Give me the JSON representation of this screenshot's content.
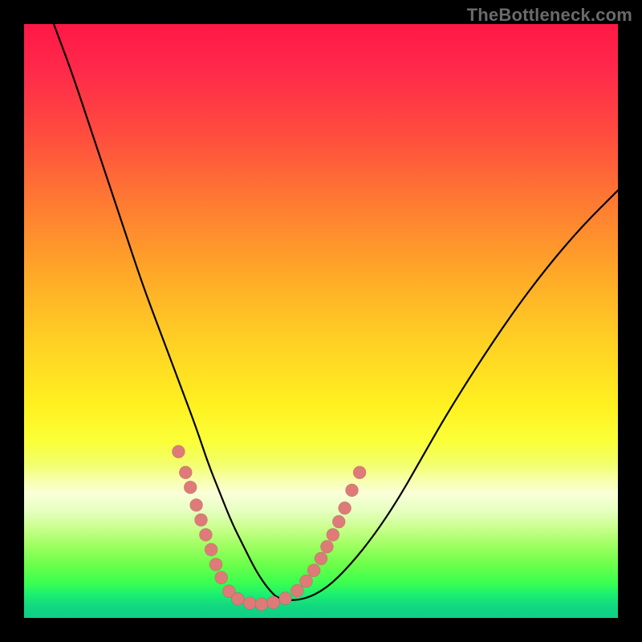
{
  "watermark": "TheBottleneck.com",
  "chart_data": {
    "type": "line",
    "title": "",
    "xlabel": "",
    "ylabel": "",
    "xlim": [
      0,
      100
    ],
    "ylim": [
      0,
      100
    ],
    "legend": false,
    "grid": false,
    "series": [
      {
        "name": "bottleneck-curve",
        "x": [
          5,
          8,
          11,
          14,
          17,
          20,
          23,
          26,
          29,
          31,
          33,
          35,
          37,
          39,
          41,
          43,
          47,
          51,
          55,
          59,
          63,
          67,
          71,
          76,
          82,
          88,
          94,
          100
        ],
        "values": [
          100,
          92,
          83,
          74,
          65,
          56,
          48,
          40,
          32,
          26,
          21,
          16,
          12,
          8,
          5,
          3,
          3,
          5,
          9,
          14,
          20,
          27,
          34,
          42,
          51,
          59,
          66,
          72
        ]
      }
    ],
    "markers": {
      "name": "curve-beads",
      "color": "#de7a78",
      "points_xy": [
        [
          26.0,
          28.0
        ],
        [
          27.2,
          24.5
        ],
        [
          28.0,
          22.0
        ],
        [
          29.0,
          19.0
        ],
        [
          29.8,
          16.5
        ],
        [
          30.6,
          14.0
        ],
        [
          31.5,
          11.5
        ],
        [
          32.3,
          9.0
        ],
        [
          33.2,
          6.8
        ],
        [
          34.5,
          4.5
        ],
        [
          36.0,
          3.2
        ],
        [
          38.0,
          2.5
        ],
        [
          40.0,
          2.3
        ],
        [
          42.0,
          2.6
        ],
        [
          44.0,
          3.3
        ],
        [
          46.0,
          4.6
        ],
        [
          47.5,
          6.2
        ],
        [
          48.8,
          8.0
        ],
        [
          50.0,
          10.0
        ],
        [
          51.0,
          12.0
        ],
        [
          52.0,
          14.0
        ],
        [
          53.0,
          16.2
        ],
        [
          54.0,
          18.5
        ],
        [
          55.2,
          21.5
        ],
        [
          56.5,
          24.5
        ]
      ]
    },
    "background_gradient": {
      "direction": "vertical",
      "stops": [
        {
          "pos": 0.0,
          "color": "#ff1846"
        },
        {
          "pos": 0.3,
          "color": "#ff7a32"
        },
        {
          "pos": 0.55,
          "color": "#ffd224"
        },
        {
          "pos": 0.72,
          "color": "#f5ff50"
        },
        {
          "pos": 0.8,
          "color": "#faffd8"
        },
        {
          "pos": 0.9,
          "color": "#8aff55"
        },
        {
          "pos": 1.0,
          "color": "#0ecf85"
        }
      ]
    }
  }
}
